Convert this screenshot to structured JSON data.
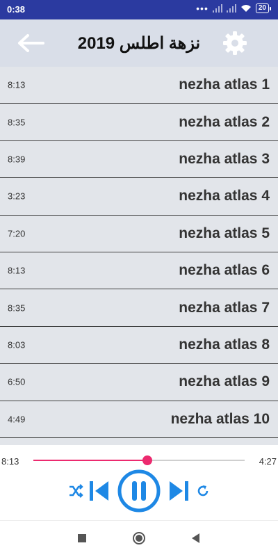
{
  "status_bar": {
    "time": "0:38",
    "battery": "20"
  },
  "header": {
    "title": "نزهة اطلس 2019"
  },
  "tracks": [
    {
      "name": "nezha atlas 1",
      "duration": "8:13"
    },
    {
      "name": "nezha atlas 2",
      "duration": "8:35"
    },
    {
      "name": "nezha atlas 3",
      "duration": "8:39"
    },
    {
      "name": "nezha atlas 4",
      "duration": "3:23"
    },
    {
      "name": "nezha atlas 5",
      "duration": "7:20"
    },
    {
      "name": "nezha atlas 6",
      "duration": "8:13"
    },
    {
      "name": "nezha atlas 7",
      "duration": "8:35"
    },
    {
      "name": "nezha atlas 8",
      "duration": "8:03"
    },
    {
      "name": "nezha atlas 9",
      "duration": "6:50"
    },
    {
      "name": "nezha atlas 10",
      "duration": "4:49"
    }
  ],
  "player": {
    "current_time": "8:13",
    "total_time": "4:27",
    "progress": 0.54,
    "state": "playing",
    "accent_color": "#1e88e5",
    "progress_color": "#ec2a6f"
  },
  "icons": {
    "back": "arrow-left-icon",
    "settings": "gear-icon",
    "shuffle": "shuffle-icon",
    "previous": "skip-previous-icon",
    "pause": "pause-icon",
    "next": "skip-next-icon",
    "repeat": "repeat-icon"
  }
}
